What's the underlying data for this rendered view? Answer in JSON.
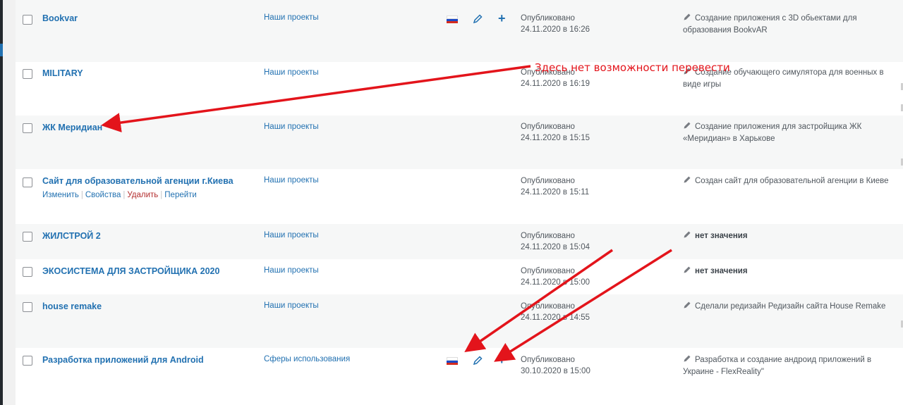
{
  "colors": {
    "link": "#2271b1",
    "annotation": "#e3141b",
    "delete": "#b32d2e"
  },
  "icons": {
    "edit": "pencil-icon",
    "add": "plus-icon",
    "language": "flag-ru-icon"
  },
  "annotation_text": "Здесь нет возможности перевести",
  "rows": [
    {
      "title": "Bookvar",
      "category": "Наши проекты",
      "status": "Опубликовано",
      "date": "24.11.2020 в 16:26",
      "desc_line1": "Создание приложения с 3D обьектами для",
      "desc_line2": "образования BookvAR"
    },
    {
      "title": "MILITARY",
      "category": "Наши проекты",
      "status": "Опубликовано",
      "date": "24.11.2020 в 16:19",
      "desc_line1": "Создание обучающего симулятора для военных в",
      "desc_line2": "виде игры"
    },
    {
      "title": "ЖК Меридиан",
      "category": "Наши проекты",
      "status": "Опубликовано",
      "date": "24.11.2020 в 15:15",
      "desc_line1": "Создание приложения для застройщика ЖК",
      "desc_line2": "«Меридиан» в Харькове"
    },
    {
      "title": "Сайт для образовательной агенции г.Киева",
      "category": "Наши проекты",
      "status": "Опубликовано",
      "date": "24.11.2020 в 15:11",
      "desc_line1": "Создан сайт для образовательной агенции в Киеве",
      "actions": {
        "edit": "Изменить",
        "props": "Свойства",
        "delete": "Удалить",
        "go": "Перейти"
      }
    },
    {
      "title": "ЖИЛСТРОЙ 2",
      "category": "Наши проекты",
      "status": "Опубликовано",
      "date": "24.11.2020 в 15:04",
      "desc_line1": "нет значения"
    },
    {
      "title": "ЭКОСИСТЕМА ДЛЯ ЗАСТРОЙЩИКА 2020",
      "category": "Наши проекты",
      "status": "Опубликовано",
      "date": "24.11.2020 в 15:00",
      "desc_line1": "нет значения"
    },
    {
      "title": "house remake",
      "category": "Наши проекты",
      "status": "Опубликовано",
      "date": "24.11.2020 в 14:55",
      "desc_line1": "Сделали редизайн Редизайн сайта House Remake"
    },
    {
      "title": "Разработка приложений для Android",
      "category": "Сферы использования",
      "status": "Опубликовано",
      "date": "30.10.2020 в 15:00",
      "desc_line1": "Разработка и создание андроид приложений в",
      "desc_line2": "Украине - FlexReality\""
    }
  ]
}
